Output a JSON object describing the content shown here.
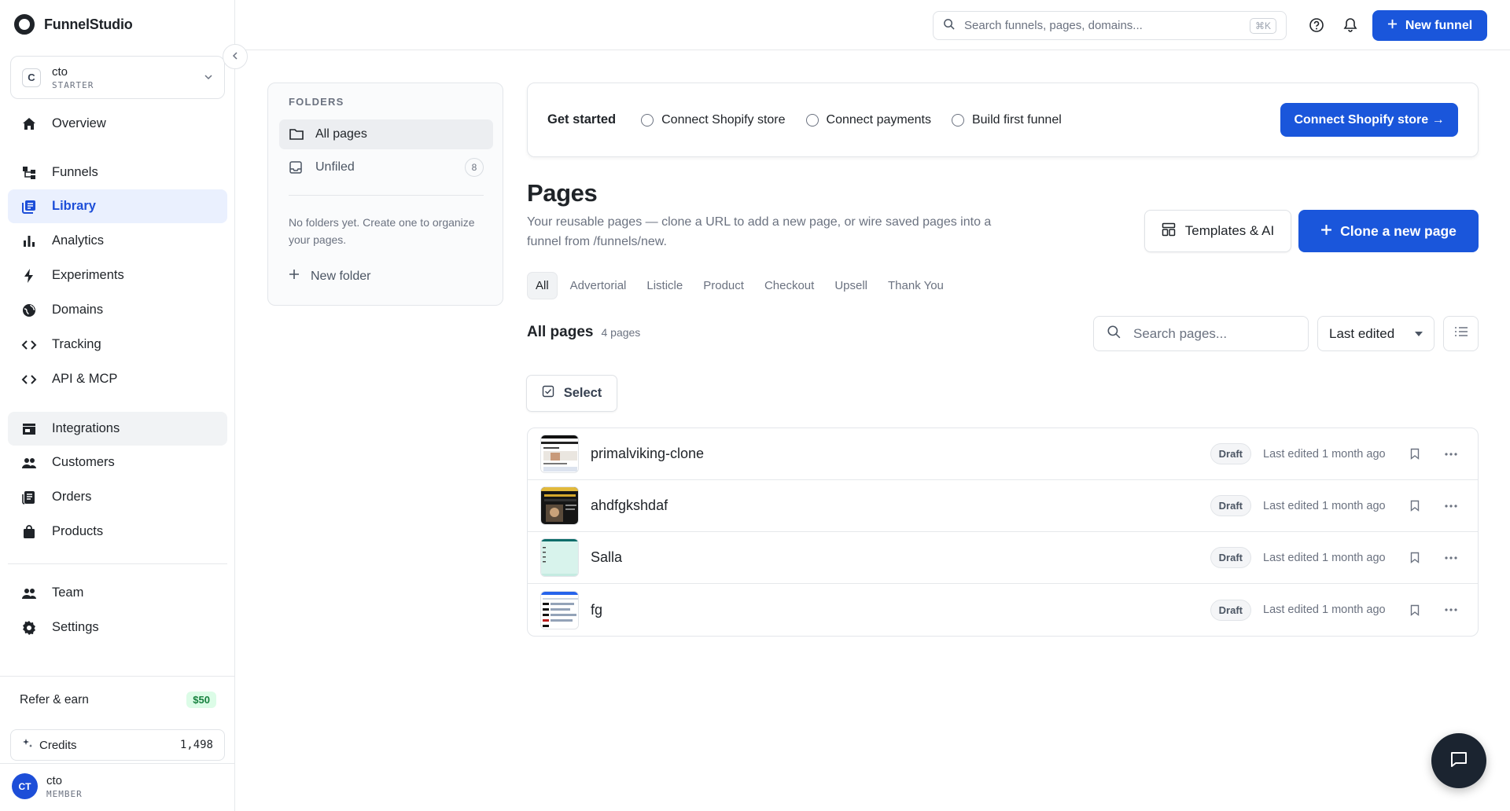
{
  "app": {
    "name": "FunnelStudio"
  },
  "org": {
    "avatar": "C",
    "name": "cto",
    "plan": "STARTER"
  },
  "sidebar": {
    "items": [
      {
        "label": "Overview",
        "icon": "home-icon"
      },
      {
        "label": "Funnels",
        "icon": "funnel-tree-icon"
      },
      {
        "label": "Library",
        "icon": "library-icon",
        "active": true
      },
      {
        "label": "Analytics",
        "icon": "bar-chart-icon"
      },
      {
        "label": "Experiments",
        "icon": "lightning-icon"
      },
      {
        "label": "Domains",
        "icon": "globe-icon"
      },
      {
        "label": "Tracking",
        "icon": "code-icon"
      },
      {
        "label": "API & MCP",
        "icon": "code-icon"
      },
      {
        "label": "Integrations",
        "icon": "store-icon"
      },
      {
        "label": "Customers",
        "icon": "people-icon"
      },
      {
        "label": "Orders",
        "icon": "receipt-icon"
      },
      {
        "label": "Products",
        "icon": "shopping-bag-icon"
      },
      {
        "label": "Team",
        "icon": "people-icon"
      },
      {
        "label": "Settings",
        "icon": "gear-icon"
      }
    ],
    "refer": {
      "label": "Refer & earn",
      "badge": "$50"
    },
    "credits": {
      "label": "Credits",
      "value": "1,498"
    },
    "user": {
      "initials": "CT",
      "name": "cto",
      "role": "MEMBER"
    }
  },
  "topbar": {
    "search_placeholder": "Search funnels, pages, domains...",
    "shortcut": "⌘K",
    "new_funnel_label": "New funnel"
  },
  "folders": {
    "title": "FOLDERS",
    "items": [
      {
        "label": "All pages",
        "active": true
      },
      {
        "label": "Unfiled",
        "count": "8"
      }
    ],
    "empty_text": "No folders yet. Create one to organize your pages.",
    "new_folder_label": "New folder"
  },
  "get_started": {
    "title": "Get started",
    "steps": [
      "Connect Shopify store",
      "Connect payments",
      "Build first funnel"
    ],
    "cta": "Connect Shopify store →"
  },
  "pages": {
    "title": "Pages",
    "description": "Your reusable pages — clone a URL to add a new page, or wire saved pages into a funnel from /funnels/new.",
    "templates_label": "Templates & AI",
    "clone_label": "Clone a new page",
    "tabs": [
      "All",
      "Advertorial",
      "Listicle",
      "Product",
      "Checkout",
      "Upsell",
      "Thank You"
    ],
    "section_title": "All pages",
    "section_count": "4 pages",
    "search_placeholder": "Search pages...",
    "sort_value": "Last edited",
    "select_label": "Select",
    "rows": [
      {
        "name": "primalviking-clone",
        "status": "Draft",
        "edited": "Last edited 1 month ago",
        "thumb": "light-store"
      },
      {
        "name": "ahdfgkshdaf",
        "status": "Draft",
        "edited": "Last edited 1 month ago",
        "thumb": "dark-gold"
      },
      {
        "name": "Salla",
        "status": "Draft",
        "edited": "Last edited 1 month ago",
        "thumb": "mint"
      },
      {
        "name": "fg",
        "status": "Draft",
        "edited": "Last edited 1 month ago",
        "thumb": "blue-list"
      }
    ]
  },
  "colors": {
    "primary": "#1a56db",
    "active_bg": "#eaf0fe",
    "chat_bg": "#1b2430"
  }
}
